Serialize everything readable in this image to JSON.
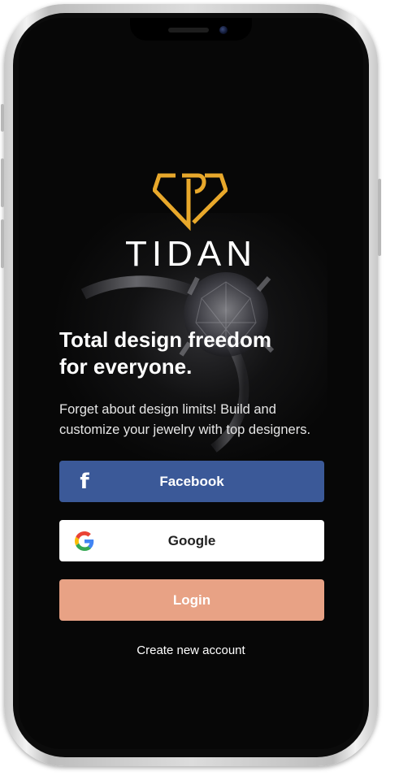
{
  "app": {
    "brand": "TIDAN",
    "headline_line1": "Total design freedom",
    "headline_line2": "for everyone.",
    "subtext": "Forget about design limits! Build and customize your jewelry with top designers."
  },
  "buttons": {
    "facebook_label": "Facebook",
    "google_label": "Google",
    "login_label": "Login",
    "create_account_label": "Create new account"
  },
  "icons": {
    "logo": "diamond-logo-icon",
    "facebook": "facebook-f-icon",
    "google": "google-g-icon"
  },
  "colors": {
    "accent_gold": "#e8a82b",
    "facebook_blue": "#3b5998",
    "login_peach": "#e8a285",
    "background": "#070707"
  }
}
